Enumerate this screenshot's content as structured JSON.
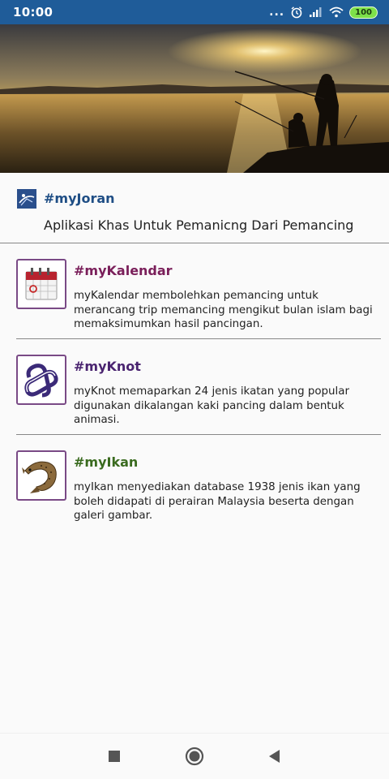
{
  "status_bar": {
    "time": "10:00",
    "dots": "...",
    "battery": "100",
    "icons": [
      "alarm-icon",
      "signal-icon",
      "wifi-icon",
      "battery-icon"
    ],
    "bg_color": "#1f5c99"
  },
  "hero": {
    "image": "sunset-fishing-photo"
  },
  "header": {
    "app_name": "#myJoran",
    "tagline": "Aplikasi Khas Untuk Pemanicng Dari Pemancing",
    "logo_icon": "myjoran-logo-icon"
  },
  "features": [
    {
      "title": "#myKalendar",
      "title_color": "#7a1f5a",
      "icon": "calendar-icon",
      "description": "myKalendar membolehkan pemancing untuk merancang trip memancing mengikut bulan islam bagi memaksimumkan hasil pancingan."
    },
    {
      "title": "#myKnot",
      "title_color": "#4a2470",
      "icon": "knot-icon",
      "description": "myKnot memaparkan 24 jenis ikatan yang popular digunakan dikalangan kaki pancing dalam bentuk animasi."
    },
    {
      "title": "#myIkan",
      "title_color": "#3a6b1f",
      "icon": "fish-icon",
      "description": "myIkan menyediakan database 1938 jenis ikan yang boleh didapati di perairan Malaysia beserta dengan galeri gambar."
    }
  ],
  "nav": {
    "recents": "recents-square-icon",
    "home": "home-circle-icon",
    "back": "back-triangle-icon"
  }
}
